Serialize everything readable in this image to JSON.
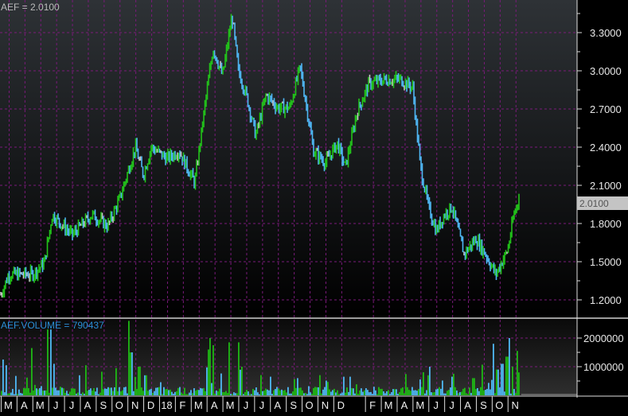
{
  "chart_data": [
    {
      "type": "line",
      "title": "AEF = 2.0100",
      "last_value_label": "2.0100",
      "ylim": [
        1.05,
        3.55
      ],
      "yticks": [
        "3.3000",
        "3.0000",
        "2.7000",
        "2.4000",
        "2.1000",
        "1.8000",
        "1.5000",
        "1.2000"
      ],
      "ytick_values": [
        3.3,
        3.0,
        2.7,
        2.4,
        2.1,
        1.8,
        1.5,
        1.2
      ],
      "grid": true,
      "series_colors": {
        "up": "#22c41a",
        "down": "#4fb8f5",
        "flat": "#c8c8c8"
      },
      "x_unit": "months from start",
      "points": [
        [
          0,
          1.24
        ],
        [
          0.5,
          1.4
        ],
        [
          2,
          1.4
        ],
        [
          2.75,
          1.49
        ],
        [
          3.25,
          1.87
        ],
        [
          4.5,
          1.71
        ],
        [
          5.75,
          1.87
        ],
        [
          6.75,
          1.78
        ],
        [
          7.5,
          1.99
        ],
        [
          8.5,
          2.4
        ],
        [
          9,
          2.18
        ],
        [
          9.5,
          2.4
        ],
        [
          10.5,
          2.31
        ],
        [
          11.25,
          2.37
        ],
        [
          12.25,
          2.12
        ],
        [
          12.9,
          2.74
        ],
        [
          13.4,
          3.18
        ],
        [
          14,
          2.96
        ],
        [
          14.6,
          3.43
        ],
        [
          15,
          3.0
        ],
        [
          15.5,
          2.81
        ],
        [
          16.1,
          2.49
        ],
        [
          16.75,
          2.81
        ],
        [
          17.5,
          2.71
        ],
        [
          18.25,
          2.71
        ],
        [
          18.9,
          3.03
        ],
        [
          19.75,
          2.37
        ],
        [
          20.5,
          2.28
        ],
        [
          21.25,
          2.43
        ],
        [
          21.75,
          2.24
        ],
        [
          22.5,
          2.68
        ],
        [
          23.25,
          2.9
        ],
        [
          24.25,
          2.93
        ],
        [
          25.25,
          2.93
        ],
        [
          26,
          2.87
        ],
        [
          26.5,
          2.24
        ],
        [
          27,
          1.93
        ],
        [
          27.5,
          1.74
        ],
        [
          28,
          1.87
        ],
        [
          28.5,
          1.93
        ],
        [
          29.25,
          1.56
        ],
        [
          30,
          1.68
        ],
        [
          30.6,
          1.56
        ],
        [
          31.25,
          1.4
        ],
        [
          32,
          1.59
        ],
        [
          32.4,
          1.87
        ],
        [
          32.75,
          2.01
        ]
      ]
    },
    {
      "type": "bar",
      "title": "AEF.VOLUME = 790437",
      "ylim": [
        0,
        2600000
      ],
      "yticks": [
        "2000000",
        "1000000"
      ],
      "ytick_values": [
        2000000,
        1000000
      ],
      "grid": true,
      "baseline": 120000,
      "spikes": [
        [
          0.1,
          1250000
        ],
        [
          0.3,
          1050000
        ],
        [
          1.9,
          1650000
        ],
        [
          2.9,
          2300000
        ],
        [
          3.1,
          2300000
        ],
        [
          3.3,
          1100000
        ],
        [
          5.3,
          1050000
        ],
        [
          7.2,
          950000
        ],
        [
          8.05,
          2600000
        ],
        [
          8.2,
          1500000
        ],
        [
          8.7,
          1000000
        ],
        [
          9.1,
          700000
        ],
        [
          13.1,
          1600000
        ],
        [
          13.2,
          2000000
        ],
        [
          13.4,
          1750000
        ],
        [
          14.4,
          1850000
        ],
        [
          15.0,
          1850000
        ],
        [
          15.15,
          1000000
        ],
        [
          17.0,
          650000
        ],
        [
          18.7,
          600000
        ],
        [
          21.6,
          650000
        ],
        [
          22.0,
          650000
        ],
        [
          26.9,
          700000
        ],
        [
          27.0,
          1000000
        ],
        [
          28.5,
          650000
        ],
        [
          29.8,
          600000
        ],
        [
          31.05,
          1800000
        ],
        [
          31.3,
          900000
        ],
        [
          31.6,
          1100000
        ],
        [
          31.9,
          1350000
        ],
        [
          32.05,
          2000000
        ],
        [
          32.3,
          1000000
        ],
        [
          32.55,
          1550000
        ],
        [
          32.65,
          800000
        ]
      ],
      "x_labels": [
        "M",
        "A",
        "M",
        "J",
        "J",
        "A",
        "S",
        "O",
        "N",
        "D",
        "18",
        "F",
        "M",
        "A",
        "M",
        "J",
        "J",
        "A",
        "S",
        "O",
        "N",
        "D",
        "F",
        "M",
        "A",
        "M",
        "J",
        "J",
        "A",
        "S",
        "O",
        "N"
      ],
      "x_label_positions_months": [
        1,
        2,
        3,
        4,
        5,
        6,
        7,
        8,
        9,
        10,
        11,
        12,
        13,
        14,
        15,
        16,
        17,
        18,
        19,
        20,
        21,
        22,
        24,
        25,
        26,
        27,
        28,
        29,
        30,
        31,
        32,
        33
      ]
    }
  ]
}
